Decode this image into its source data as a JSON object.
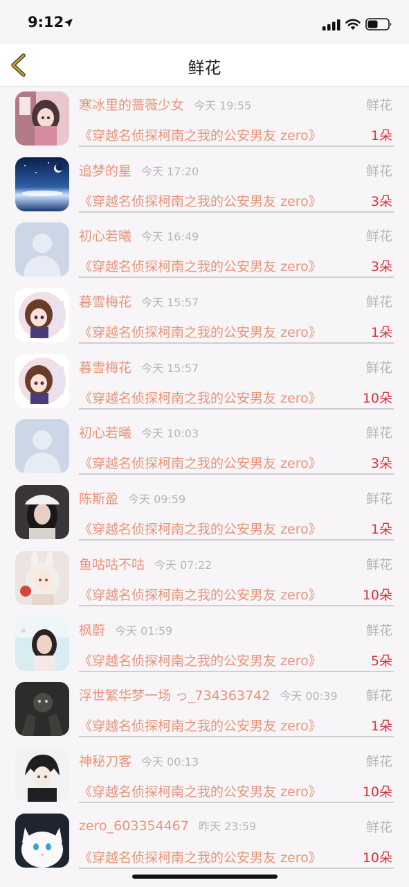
{
  "status_bar": {
    "time": "9:12"
  },
  "header": {
    "title": "鲜花",
    "back_icon": "chevron-left-icon",
    "accent": "#c8a21e"
  },
  "colors": {
    "name": "#e8957a",
    "count": "#d9343d",
    "muted": "#b8b4b9"
  },
  "items": [
    {
      "name": "寒冰里的蔷薇少女",
      "time": "今天 19:55",
      "label": "鲜花",
      "book": "《穿越名侦探柯南之我的公安男友 zero》",
      "count": "1朵",
      "avatar": "anime-girl-pink"
    },
    {
      "name": "追梦的星",
      "time": "今天 17:20",
      "label": "鲜花",
      "book": "《穿越名侦探柯南之我的公安男友 zero》",
      "count": "3朵",
      "avatar": "night-sky"
    },
    {
      "name": "初心若曦",
      "time": "今天 16:49",
      "label": "鲜花",
      "book": "《穿越名侦探柯南之我的公安男友 zero》",
      "count": "3朵",
      "avatar": "default-user"
    },
    {
      "name": "暮雪梅花",
      "time": "今天 15:57",
      "label": "鲜花",
      "book": "《穿越名侦探柯南之我的公安男友 zero》",
      "count": "1朵",
      "avatar": "anime-girl-brown"
    },
    {
      "name": "暮雪梅花",
      "time": "今天 15:57",
      "label": "鲜花",
      "book": "《穿越名侦探柯南之我的公安男友 zero》",
      "count": "10朵",
      "avatar": "anime-girl-brown"
    },
    {
      "name": "初心若曦",
      "time": "今天 10:03",
      "label": "鲜花",
      "book": "《穿越名侦探柯南之我的公安男友 zero》",
      "count": "3朵",
      "avatar": "default-user"
    },
    {
      "name": "陈斯盈",
      "time": "今天 09:59",
      "label": "鲜花",
      "book": "《穿越名侦探柯南之我的公安男友 zero》",
      "count": "1朵",
      "avatar": "photo-girl-cap"
    },
    {
      "name": "鱼咕咕不咕",
      "time": "今天 07:22",
      "label": "鲜花",
      "book": "《穿越名侦探柯南之我的公安男友 zero》",
      "count": "10朵",
      "avatar": "anime-bunny-girl"
    },
    {
      "name": "枫蔚",
      "time": "今天 01:59",
      "label": "鲜花",
      "book": "《穿越名侦探柯南之我的公安男友 zero》",
      "count": "5朵",
      "avatar": "photo-girl-light"
    },
    {
      "name": "浮世繁华梦一场 っ_734363742",
      "time": "今天 00:39",
      "label": "鲜花",
      "book": "《穿越名侦探柯南之我的公安男友 zero》",
      "count": "1朵",
      "avatar": "dark-cat-hands"
    },
    {
      "name": "神秘刀客",
      "time": "今天 00:13",
      "label": "鲜花",
      "book": "《穿越名侦探柯南之我的公安男友 zero》",
      "count": "10朵",
      "avatar": "anime-boy-dark"
    },
    {
      "name": "zero_603354467",
      "time": "昨天 23:59",
      "label": "鲜花",
      "book": "《穿越名侦探柯南之我的公安男友 zero》",
      "count": "10朵",
      "avatar": "white-cat"
    }
  ]
}
